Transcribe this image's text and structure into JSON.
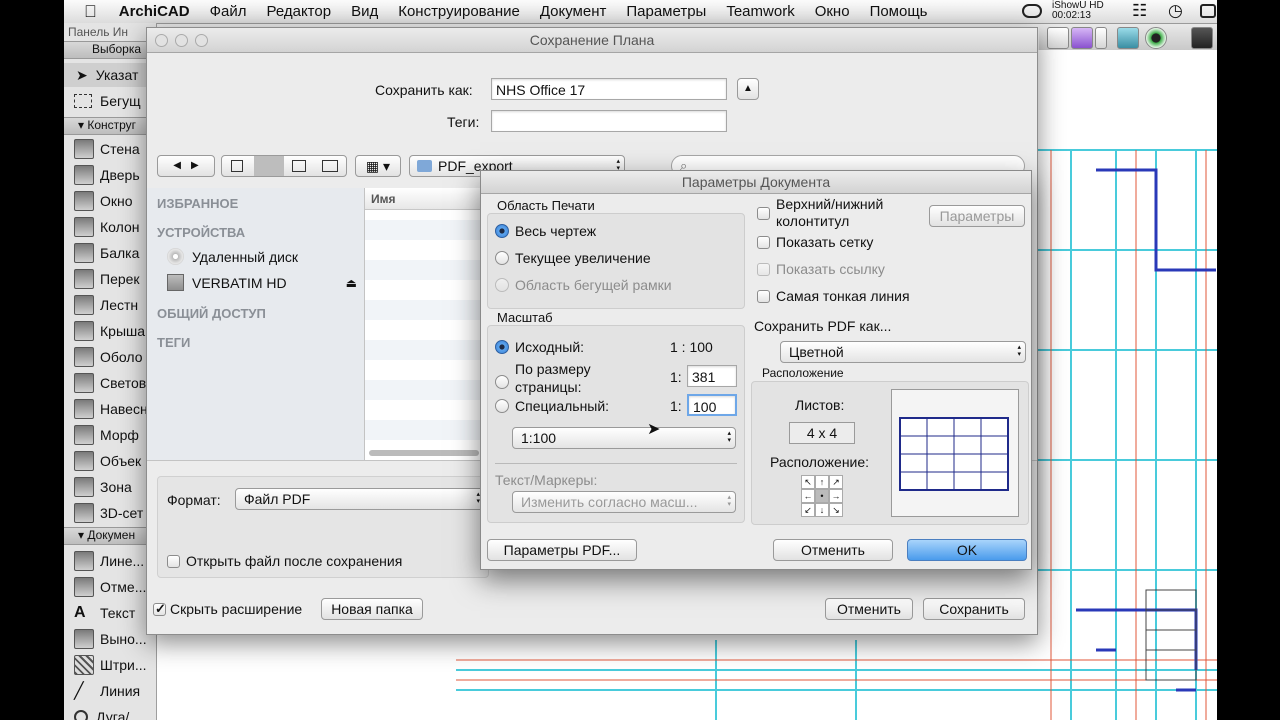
{
  "menubar": {
    "app": "ArchiCAD",
    "items": [
      "Файл",
      "Редактор",
      "Вид",
      "Конструирование",
      "Документ",
      "Параметры",
      "Teamwork",
      "Окно",
      "Помощь"
    ],
    "recorder_label": "iShowU HD",
    "recorder_time": "00:02:13"
  },
  "toolbox": {
    "panel_label": "Панель Ин",
    "selection_label": "Выборка",
    "items_top": [
      "Указат",
      "Бегущ"
    ],
    "construct_header": "Конструг",
    "construct_items": [
      "Стена",
      "Дверь",
      "Окно",
      "Колон",
      "Балка",
      "Перек",
      "Лестн",
      "Крыша",
      "Оболо",
      "Светов",
      "Навесн",
      "Морф",
      "Объек",
      "Зона",
      "3D-сет"
    ],
    "document_header": "Докумен",
    "document_items": [
      "Лине...",
      "Отме...",
      "Текст",
      "Выно...",
      "Штри...",
      "Линия",
      "Дуга/..."
    ]
  },
  "save_dialog": {
    "title": "Сохранение Плана",
    "save_as_label": "Сохранить как:",
    "save_as_value": "NHS Office 17",
    "tags_label": "Теги:",
    "tags_value": "",
    "folder": "PDF_export",
    "search_placeholder": "",
    "sidebar": {
      "favorites": "ИЗБРАННОЕ",
      "devices": "УСТРОЙСТВА",
      "device_items": [
        "Удаленный диск",
        "VERBATIM HD"
      ],
      "shared": "ОБЩИЙ ДОСТУП",
      "tags": "ТЕГИ"
    },
    "column_name": "Имя",
    "format_label": "Формат:",
    "format_value": "Файл PDF",
    "open_after_label": "Открыть файл после сохранения",
    "hide_ext_label": "Скрыть расширение",
    "new_folder": "Новая папка",
    "cancel": "Отменить",
    "save": "Сохранить"
  },
  "doc_dialog": {
    "title": "Параметры Документа",
    "print_area": {
      "title": "Область Печати",
      "options": [
        "Весь чертеж",
        "Текущее увеличение",
        "Область бегущей рамки"
      ],
      "selected": 0
    },
    "scale": {
      "title": "Масштаб",
      "original_label": "Исходный:",
      "original_value": "1 : 100",
      "fit_label_1": "По размеру",
      "fit_label_2": "страницы:",
      "fit_prefix": "1:",
      "fit_value": "381",
      "custom_label": "Специальный:",
      "custom_prefix": "1:",
      "custom_value": "100",
      "preset": "1:100"
    },
    "text_markers": {
      "label": "Текст/Маркеры:",
      "value": "Изменить согласно масш..."
    },
    "options": {
      "header_footer_1": "Верхний/нижний",
      "header_footer_2": "колонтитул",
      "params_button": "Параметры",
      "show_grid": "Показать сетку",
      "show_link": "Показать ссылку",
      "thinnest_line": "Самая тонкая линия"
    },
    "save_pdf_as_label": "Сохранить PDF как...",
    "save_pdf_as_value": "Цветной",
    "layout": {
      "title": "Расположение",
      "sheets_label": "Листов:",
      "sheets_value": "4 x 4",
      "placement_label": "Расположение:",
      "arrows": [
        "↖",
        "↑",
        "↗",
        "←",
        "•",
        "→",
        "↙",
        "↓",
        "↘"
      ]
    },
    "pdf_params_button": "Параметры PDF...",
    "cancel": "Отменить",
    "ok": "OK"
  }
}
